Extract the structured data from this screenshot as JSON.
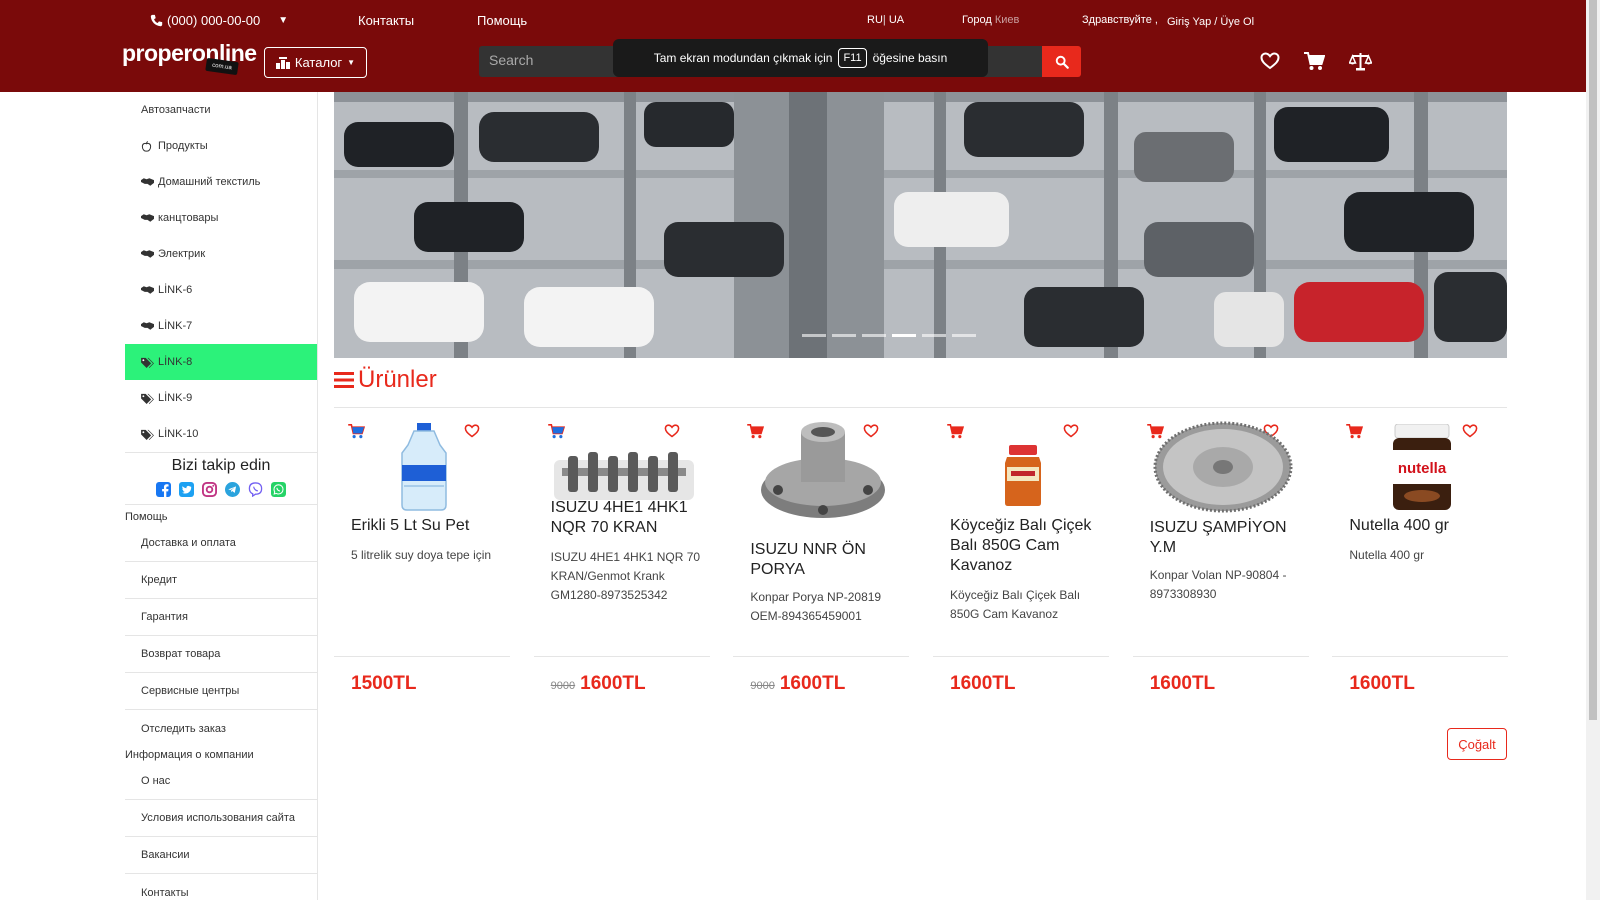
{
  "header": {
    "phone": "(000) 000-00-00",
    "links": [
      "Контакты",
      "Помощь"
    ],
    "lang_ru": "RU",
    "lang_ua": "UA",
    "city_label": "Город",
    "city_name": "Киев",
    "greeting": "Здравствуйте ,",
    "login": "Giriş Yap / Üye Ol",
    "logo": "properonline",
    "logo_badge": "com.ua",
    "catalog_label": "Каталог",
    "search_placeholder": "Search",
    "colors": {
      "bar": "#7a0a0a",
      "accent": "#e8291c",
      "active": "#2cf27a"
    }
  },
  "toast": {
    "before": "Tam ekran modundan çıkmak için",
    "key": "F11",
    "after": "öğesine basın"
  },
  "sidebar": {
    "categories": [
      {
        "label": "Автозапчасти",
        "icon": ""
      },
      {
        "label": "Продукты",
        "icon": "apple-icon"
      },
      {
        "label": "Домашний текстиль",
        "icon": "handshake-icon"
      },
      {
        "label": "канцтовары",
        "icon": "handshake-icon"
      },
      {
        "label": "Электрик",
        "icon": "handshake-icon"
      },
      {
        "label": "LİNK-6",
        "icon": "handshake-icon"
      },
      {
        "label": "LİNK-7",
        "icon": "handshake-icon"
      },
      {
        "label": "LİNK-8",
        "icon": "tags-icon"
      },
      {
        "label": "LİNK-9",
        "icon": "tags-icon"
      },
      {
        "label": "LİNK-10",
        "icon": "tags-icon"
      }
    ],
    "follow_title": "Bizi takip edin",
    "help_title": "Помощь",
    "help_items": [
      "Доставка и оплата",
      "Кредит",
      "Гарантия",
      "Возврат товара",
      "Сервисные центры",
      "Отследить заказ"
    ],
    "company_title": "Информация о компании",
    "company_items": [
      "О нас",
      "Условия использования сайта",
      "Вакансии",
      "Контакты"
    ]
  },
  "main": {
    "section_title": "Ürünler",
    "more_button": "Çoğalt",
    "products": [
      {
        "name": "Erikli 5 Lt Su Pet",
        "desc": "5 litrelik suy doya tepe için",
        "price": "1500TL",
        "old_price": ""
      },
      {
        "name": "ISUZU 4HE1 4HK1 NQR 70 KRAN",
        "desc": "ISUZU 4HE1 4HK1 NQR 70 KRAN/Genmot Krank GM1280-8973525342",
        "price": "1600TL",
        "old_price": "9000"
      },
      {
        "name": "ISUZU NNR ÖN PORYA",
        "desc": "Konpar Porya NP-20819 OEM-894365459001",
        "price": "1600TL",
        "old_price": "9000"
      },
      {
        "name": "Köyceğiz Balı Çiçek Balı 850G Cam Kavanoz",
        "desc": "Köyceğiz Balı Çiçek Balı 850G Cam Kavanoz",
        "price": "1600TL",
        "old_price": ""
      },
      {
        "name": "ISUZU ŞAMPİYON Y.M",
        "desc": "Konpar Volan NP-90804 - 8973308930",
        "price": "1600TL",
        "old_price": ""
      },
      {
        "name": "Nutella 400 gr",
        "desc": "Nutella 400 gr",
        "price": "1600TL",
        "old_price": ""
      }
    ]
  }
}
